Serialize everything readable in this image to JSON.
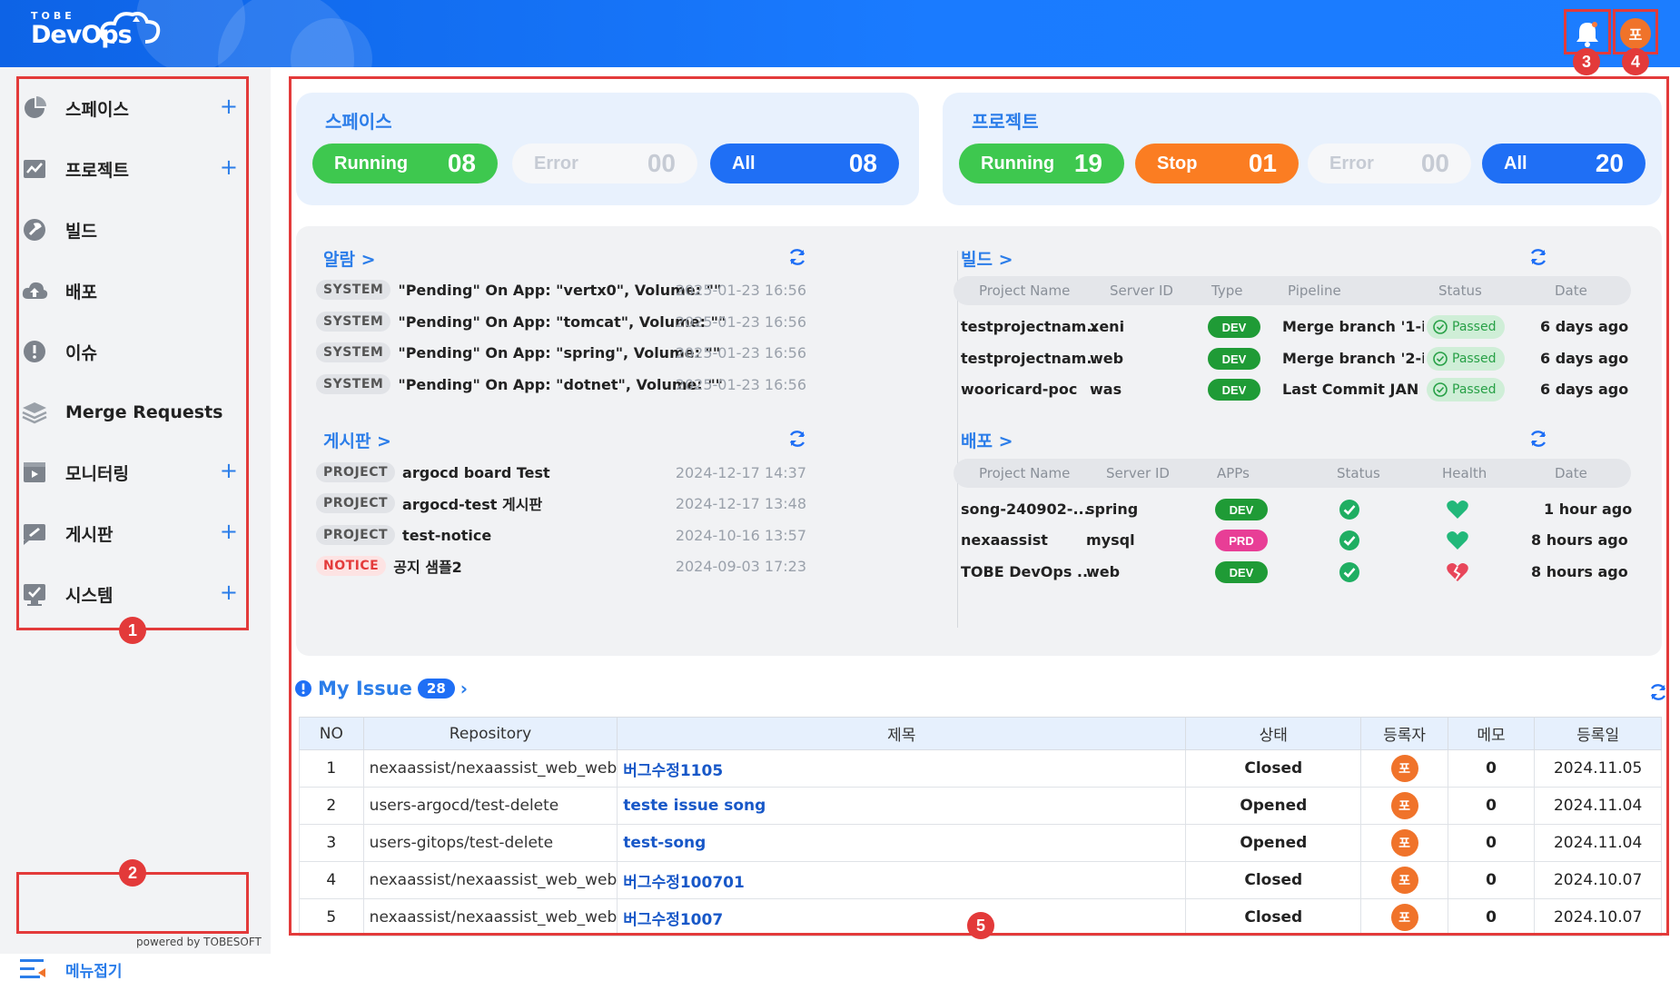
{
  "header": {
    "logo_top": "TOBE",
    "logo_main": "DevOps",
    "user_initial": "포"
  },
  "markers": [
    "1",
    "2",
    "3",
    "4",
    "5"
  ],
  "sidebar": {
    "items": [
      {
        "label": "스페이스",
        "icon": "pie-chart-icon",
        "plus": "+"
      },
      {
        "label": "프로젝트",
        "icon": "project-chart-icon",
        "plus": "+"
      },
      {
        "label": "빌드",
        "icon": "wrench-icon",
        "plus": ""
      },
      {
        "label": "배포",
        "icon": "cloud-upload-icon",
        "plus": ""
      },
      {
        "label": "이슈",
        "icon": "alert-icon",
        "plus": ""
      },
      {
        "label": "Merge Requests",
        "icon": "layers-icon",
        "plus": ""
      },
      {
        "label": "모니터링",
        "icon": "monitor-icon",
        "plus": "+"
      },
      {
        "label": "게시판",
        "icon": "board-icon",
        "plus": "+"
      },
      {
        "label": "시스템",
        "icon": "system-icon",
        "plus": "+"
      }
    ],
    "collapse_label": "메뉴접기",
    "powered": "powered by TOBESOFT"
  },
  "space_card": {
    "title": "스페이스",
    "running_label": "Running",
    "running": "08",
    "error_label": "Error",
    "error": "00",
    "all_label": "All",
    "all": "08"
  },
  "project_card": {
    "title": "프로젝트",
    "running_label": "Running",
    "running": "19",
    "stop_label": "Stop",
    "stop": "01",
    "error_label": "Error",
    "error": "00",
    "all_label": "All",
    "all": "20"
  },
  "alarms": {
    "title": "알람 >",
    "rows": [
      {
        "tag": "SYSTEM",
        "text": "\"Pending\" On App: \"vertx0\", Volume: \"\"",
        "date": "2025-01-23 16:56"
      },
      {
        "tag": "SYSTEM",
        "text": "\"Pending\" On App: \"tomcat\", Volume: \"\"",
        "date": "2025-01-23 16:56"
      },
      {
        "tag": "SYSTEM",
        "text": "\"Pending\" On App: \"spring\", Volume: \"\"",
        "date": "2025-01-23 16:56"
      },
      {
        "tag": "SYSTEM",
        "text": "\"Pending\" On App: \"dotnet\", Volume: \"\"",
        "date": "2025-01-23 16:56"
      }
    ]
  },
  "board": {
    "title": "게시판 >",
    "rows": [
      {
        "tag": "PROJECT",
        "text": "argocd board Test",
        "date": "2024-12-17 14:37"
      },
      {
        "tag": "PROJECT",
        "text": "argocd-test 게시판",
        "date": "2024-12-17 13:48"
      },
      {
        "tag": "PROJECT",
        "text": "test-notice",
        "date": "2024-10-16 13:57"
      },
      {
        "tag": "NOTICE",
        "text": "공지 샘플2",
        "date": "2024-09-03 17:23"
      }
    ]
  },
  "builds": {
    "title": "빌드 >",
    "headers": [
      "Project Name",
      "Server ID",
      "Type",
      "Pipeline",
      "Status",
      "Date"
    ],
    "rows": [
      {
        "project": "testprojectnam...",
        "server": "xeni",
        "type": "DEV",
        "pipeline": "Merge branch '1-i...",
        "status": "Passed",
        "date": "6 days ago"
      },
      {
        "project": "testprojectnam...",
        "server": "web",
        "type": "DEV",
        "pipeline": "Merge branch '2-i...",
        "status": "Passed",
        "date": "6 days ago"
      },
      {
        "project": "wooricard-poc",
        "server": "was",
        "type": "DEV",
        "pipeline": "Last Commit JAN i...",
        "status": "Passed",
        "date": "6 days ago"
      }
    ]
  },
  "deploys": {
    "title": "배포 >",
    "headers": [
      "Project Name",
      "Server ID",
      "APPs",
      "Status",
      "Health",
      "Date"
    ],
    "rows": [
      {
        "project": "song-240902-...",
        "server": "spring",
        "app": "DEV",
        "status": "ok",
        "health": "healthy",
        "date": "1 hour ago"
      },
      {
        "project": "nexaassist",
        "server": "mysql",
        "app": "PRD",
        "status": "ok",
        "health": "healthy",
        "date": "8 hours ago"
      },
      {
        "project": "TOBE DevOps ...",
        "server": "web",
        "app": "DEV",
        "status": "ok",
        "health": "broken",
        "date": "8 hours ago"
      }
    ]
  },
  "issues": {
    "title": "My Issue",
    "count": "28",
    "headers": [
      "NO",
      "Repository",
      "제목",
      "상태",
      "등록자",
      "메모",
      "등록일"
    ],
    "rows": [
      {
        "no": "1",
        "repo": "nexaassist/nexaassist_web_web",
        "title": "버그수정1105",
        "status": "Closed",
        "user": "포",
        "memo": "0",
        "date": "2024.11.05"
      },
      {
        "no": "2",
        "repo": "users-argocd/test-delete",
        "title": "teste issue song",
        "status": "Opened",
        "user": "포",
        "memo": "0",
        "date": "2024.11.04"
      },
      {
        "no": "3",
        "repo": "users-gitops/test-delete",
        "title": "test-song",
        "status": "Opened",
        "user": "포",
        "memo": "0",
        "date": "2024.11.04"
      },
      {
        "no": "4",
        "repo": "nexaassist/nexaassist_web_web",
        "title": "버그수정100701",
        "status": "Closed",
        "user": "포",
        "memo": "0",
        "date": "2024.10.07"
      },
      {
        "no": "5",
        "repo": "nexaassist/nexaassist_web_web",
        "title": "버그수정1007",
        "status": "Closed",
        "user": "포",
        "memo": "0",
        "date": "2024.10.07"
      }
    ]
  }
}
